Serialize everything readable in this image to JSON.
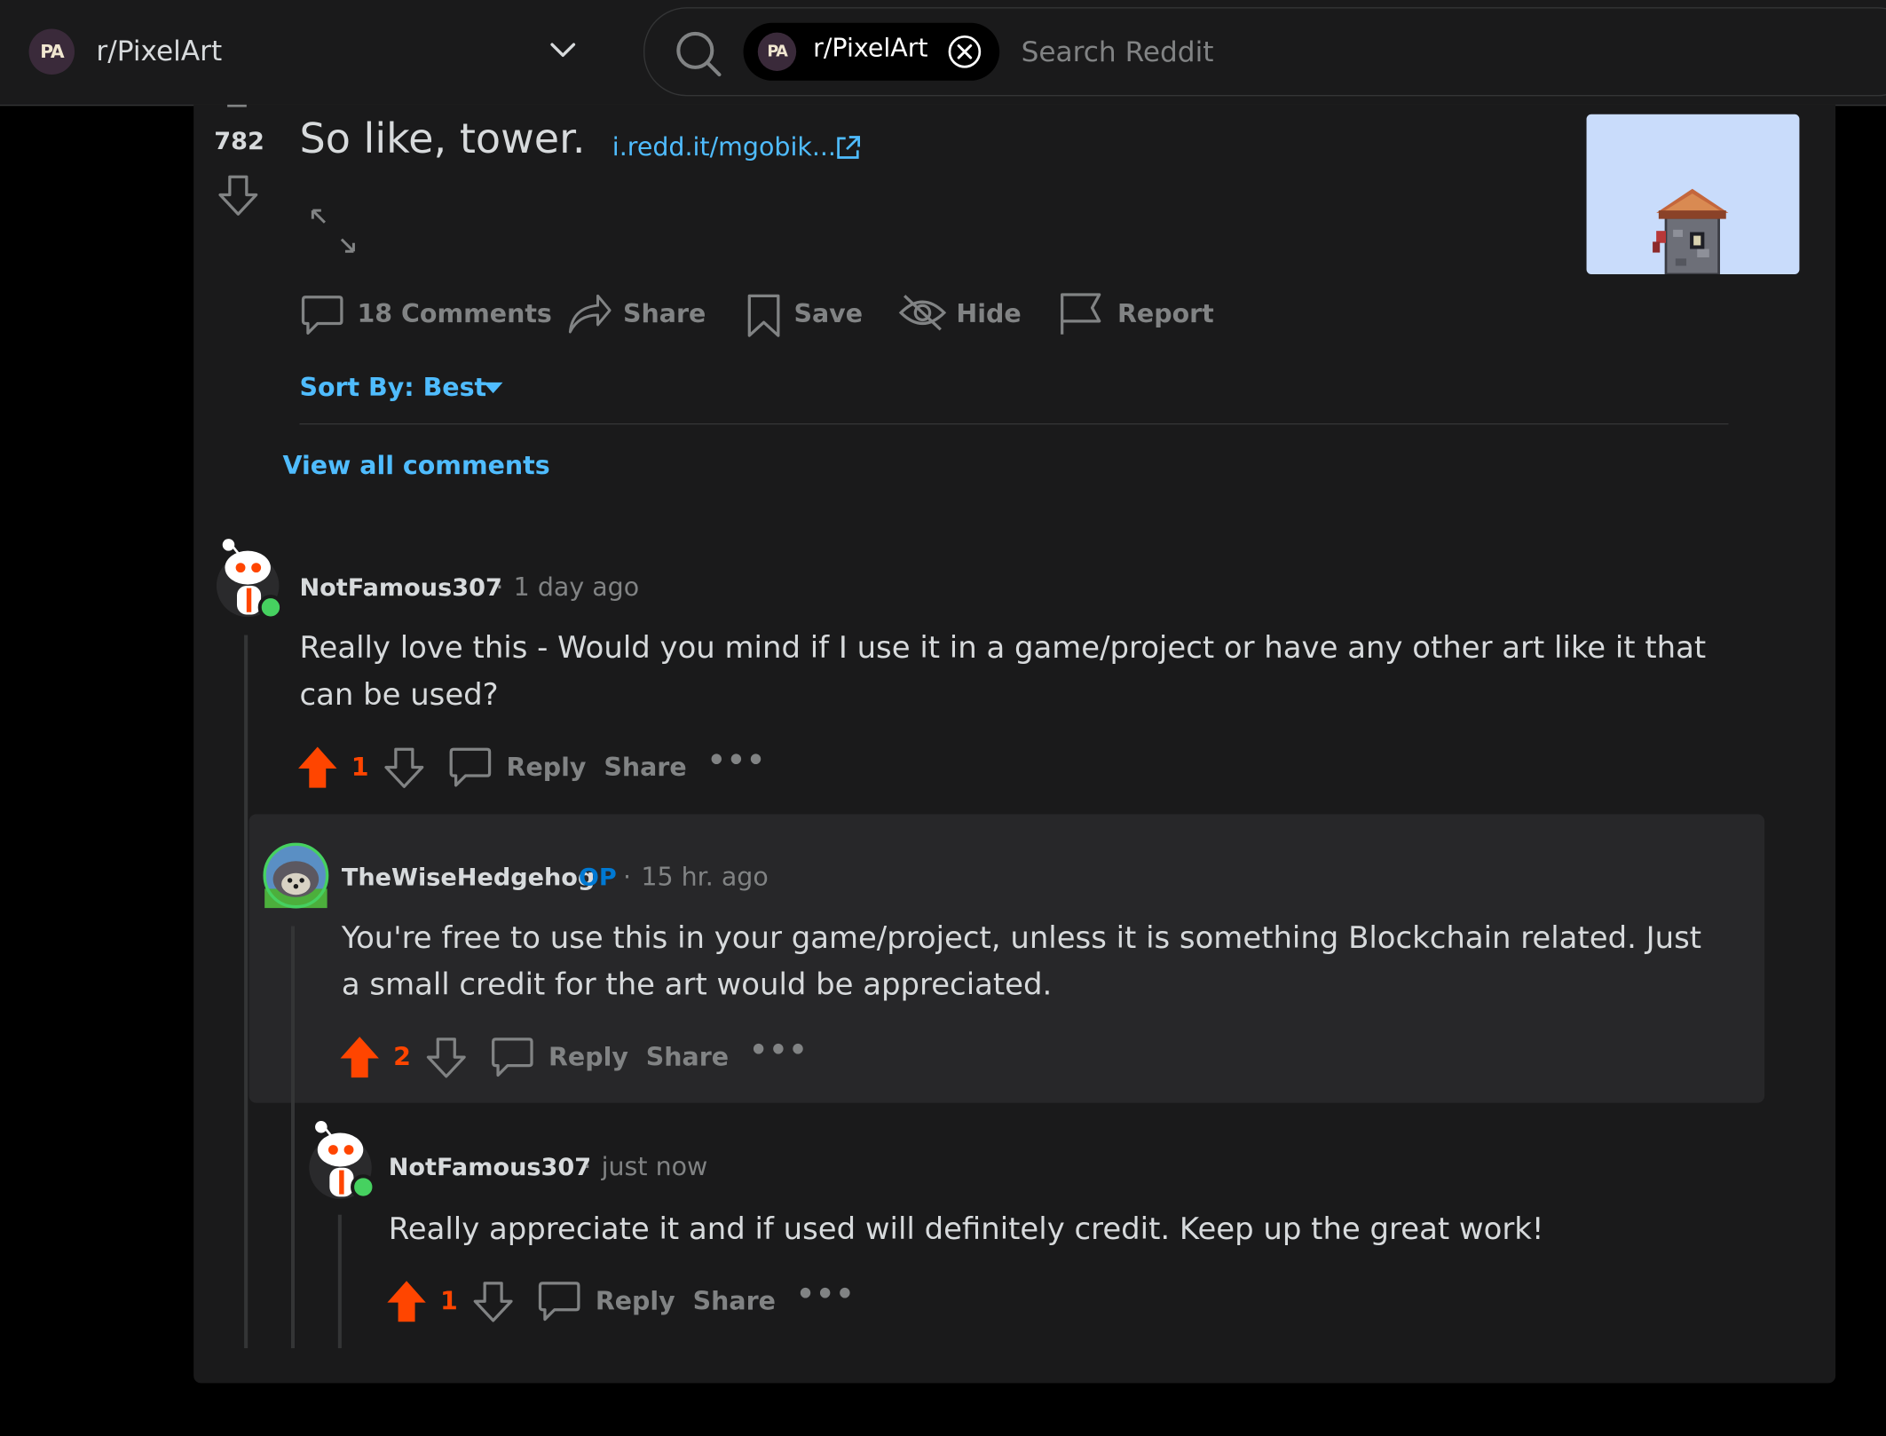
{
  "header": {
    "community_avatar_text": "PA",
    "community_name": "r/PixelArt",
    "search": {
      "chip_avatar_text": "PA",
      "chip_label": "r/PixelArt",
      "placeholder": "Search Reddit"
    }
  },
  "post": {
    "vote_count": "782",
    "title": "So like, tower.",
    "link_text": "i.redd.it/mgobik...",
    "actions": {
      "comments": "18 Comments",
      "share": "Share",
      "save": "Save",
      "hide": "Hide",
      "report": "Report"
    },
    "sort_label": "Sort By: Best",
    "view_all_comments": "View all comments"
  },
  "comments": [
    {
      "author": "NotFamous307",
      "time": "1 day ago",
      "body": "Really love this - Would you mind if I use it in a game/project or have any other art like it that can be used?",
      "score": "1",
      "reply_label": "Reply",
      "share_label": "Share",
      "more_label": "•••"
    },
    {
      "author": "TheWiseHedgehog",
      "badge": "OP",
      "time": "15 hr. ago",
      "body": "You're free to use this in your game/project, unless it is something Blockchain related. Just a small credit for the art would be appreciated.",
      "score": "2",
      "reply_label": "Reply",
      "share_label": "Share",
      "more_label": "•••"
    },
    {
      "author": "NotFamous307",
      "time": "just now",
      "body": "Really appreciate it and if used will definitely credit. Keep up the great work!",
      "score": "1",
      "reply_label": "Reply",
      "share_label": "Share",
      "more_label": "•••"
    }
  ],
  "colors": {
    "background": "#000000",
    "panel": "#1a1a1b",
    "text": "#d7dadc",
    "muted": "#818384",
    "link": "#4fbcff",
    "upvote": "#ff4500",
    "op_badge": "#0079d3",
    "online": "#46d160"
  }
}
